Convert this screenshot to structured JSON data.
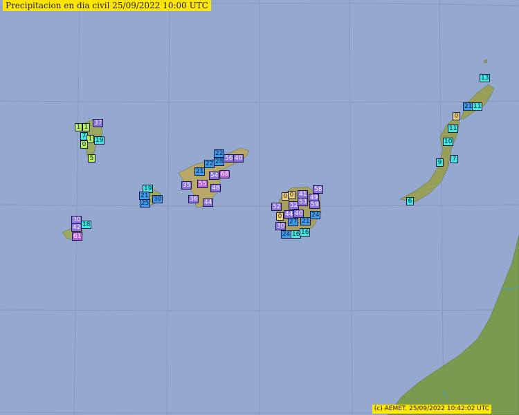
{
  "header": {
    "title": "Precipitacion en dia civil  25/09/2022 10:00 UTC"
  },
  "footer": {
    "credit": "(c) AEMET. 25/09/2022 10:42:02 UTC"
  },
  "colors": {
    "sea": "#95a8d0",
    "land": "#7a9a50",
    "land_high": "#c0b070",
    "label_bg": "#ffe600",
    "class_0": "#f0d070",
    "class_1": "#b8f060",
    "class_2": "#40e8e0",
    "class_3": "#3e9cf0",
    "class_4": "#8a70e0",
    "class_5": "#c060e0"
  },
  "stations": [
    {
      "value": "1",
      "cls": "c1"
    },
    {
      "value": "1",
      "cls": "c1"
    },
    {
      "value": "37",
      "cls": "c4"
    },
    {
      "value": "7",
      "cls": "c2"
    },
    {
      "value": "1",
      "cls": "c1"
    },
    {
      "value": "19",
      "cls": "c2"
    },
    {
      "value": "0",
      "cls": "c1"
    },
    {
      "value": "5",
      "cls": "c1"
    },
    {
      "value": "19",
      "cls": "c2"
    },
    {
      "value": "21",
      "cls": "c3"
    },
    {
      "value": "30",
      "cls": "c3"
    },
    {
      "value": "25",
      "cls": "c3"
    },
    {
      "value": "30",
      "cls": "c4"
    },
    {
      "value": "18",
      "cls": "c2"
    },
    {
      "value": "42",
      "cls": "c4"
    },
    {
      "value": "61",
      "cls": "c5"
    },
    {
      "value": "22",
      "cls": "c3"
    },
    {
      "value": "28",
      "cls": "c3"
    },
    {
      "value": "56",
      "cls": "c4"
    },
    {
      "value": "40",
      "cls": "c4"
    },
    {
      "value": "22",
      "cls": "c3"
    },
    {
      "value": "21",
      "cls": "c3"
    },
    {
      "value": "54",
      "cls": "c4"
    },
    {
      "value": "68",
      "cls": "c5"
    },
    {
      "value": "35",
      "cls": "c4"
    },
    {
      "value": "55",
      "cls": "c5"
    },
    {
      "value": "48",
      "cls": "c4"
    },
    {
      "value": "36",
      "cls": "c4"
    },
    {
      "value": "44",
      "cls": "c4"
    },
    {
      "value": "0",
      "cls": "c0"
    },
    {
      "value": "0",
      "cls": "c0"
    },
    {
      "value": "41",
      "cls": "c4"
    },
    {
      "value": "58",
      "cls": "c4"
    },
    {
      "value": "49",
      "cls": "c4"
    },
    {
      "value": "52",
      "cls": "c4"
    },
    {
      "value": "52",
      "cls": "c4"
    },
    {
      "value": "53",
      "cls": "c4"
    },
    {
      "value": "59",
      "cls": "c4"
    },
    {
      "value": "0",
      "cls": "c0"
    },
    {
      "value": "44",
      "cls": "c4"
    },
    {
      "value": "40",
      "cls": "c4"
    },
    {
      "value": "24",
      "cls": "c3"
    },
    {
      "value": "30",
      "cls": "c4"
    },
    {
      "value": "27",
      "cls": "c3"
    },
    {
      "value": "21",
      "cls": "c3"
    },
    {
      "value": "24",
      "cls": "c3"
    },
    {
      "value": "16",
      "cls": "c2"
    },
    {
      "value": "16",
      "cls": "c2"
    },
    {
      "value": "13",
      "cls": "c2"
    },
    {
      "value": "21",
      "cls": "c3"
    },
    {
      "value": "11",
      "cls": "c2"
    },
    {
      "value": "0",
      "cls": "c0"
    },
    {
      "value": "11",
      "cls": "c2"
    },
    {
      "value": "10",
      "cls": "c2"
    },
    {
      "value": "9",
      "cls": "c2"
    },
    {
      "value": "7",
      "cls": "c2"
    },
    {
      "value": "6",
      "cls": "c2"
    }
  ]
}
